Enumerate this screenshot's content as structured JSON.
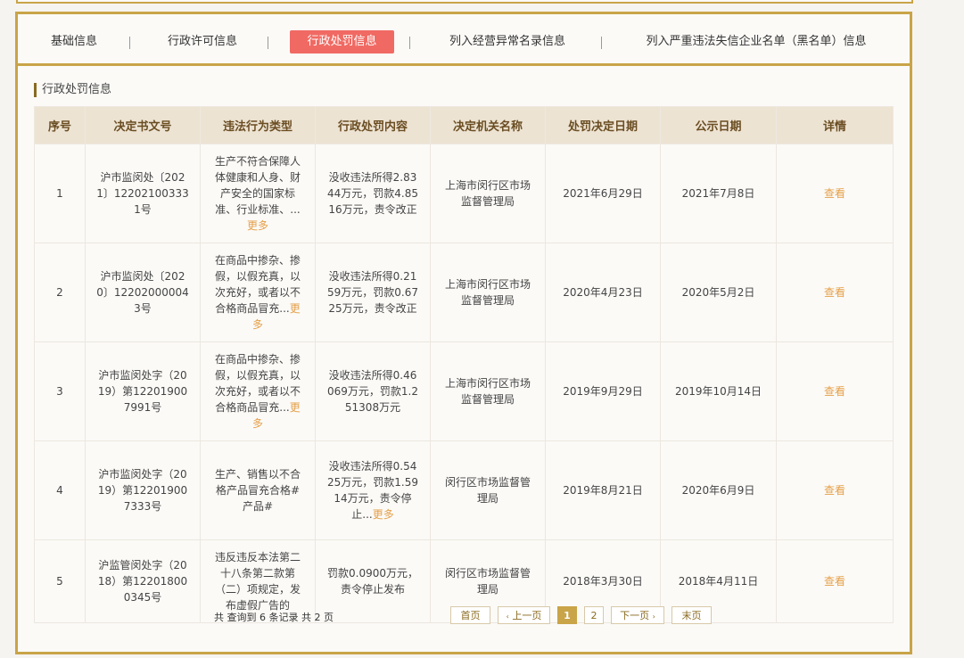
{
  "tabs": [
    {
      "label": "基础信息"
    },
    {
      "label": "行政许可信息"
    },
    {
      "label": "行政处罚信息",
      "active": true
    },
    {
      "label": "列入经营异常名录信息"
    },
    {
      "label": "列入严重违法失信企业名单（黑名单）信息"
    }
  ],
  "section_title": "行政处罚信息",
  "columns": [
    "序号",
    "决定书文号",
    "违法行为类型",
    "行政处罚内容",
    "决定机关名称",
    "处罚决定日期",
    "公示日期",
    "详情"
  ],
  "rows": [
    {
      "no": "1",
      "doc": "沪市监闵处〔2021〕122021003331号",
      "type": "生产不符合保障人体健康和人身、财产安全的国家标准、行业标准、...",
      "type_more": "更多",
      "content": "没收违法所得2.8344万元，罚款4.8516万元，责令改正",
      "content_more": "",
      "org": "上海市闵行区市场监督管理局",
      "date": "2021年6月29日",
      "pub": "2021年7月8日",
      "detail": "查看"
    },
    {
      "no": "2",
      "doc": "沪市监闵处〔2020〕122020000043号",
      "type": "在商品中掺杂、掺假，以假充真，以次充好，或者以不合格商品冒充...",
      "type_more": "更多",
      "content": "没收违法所得0.2159万元，罚款0.6725万元，责令改正",
      "content_more": "",
      "org": "上海市闵行区市场监督管理局",
      "date": "2020年4月23日",
      "pub": "2020年5月2日",
      "detail": "查看"
    },
    {
      "no": "3",
      "doc": "沪市监闵处字（2019）第122019007991号",
      "type": "在商品中掺杂、掺假，以假充真，以次充好，或者以不合格商品冒充...",
      "type_more": "更多",
      "content": "没收违法所得0.46069万元，罚款1.251308万元",
      "content_more": "",
      "org": "上海市闵行区市场监督管理局",
      "date": "2019年9月29日",
      "pub": "2019年10月14日",
      "detail": "查看"
    },
    {
      "no": "4",
      "doc": "沪市监闵处字（2019）第122019007333号",
      "type": "生产、销售以不合格产品冒充合格#产品#",
      "type_more": "",
      "content": "没收违法所得0.5425万元，罚款1.5914万元，责令停止...",
      "content_more": "更多",
      "org": "闵行区市场监督管理局",
      "date": "2019年8月21日",
      "pub": "2020年6月9日",
      "detail": "查看"
    },
    {
      "no": "5",
      "doc": "沪监管闵处字（2018）第122018000345号",
      "type": "违反违反本法第二十八条第二款第（二）项规定，发布虚假广告的",
      "type_more": "",
      "content": "罚款0.0900万元，责令停止发布",
      "content_more": "",
      "org": "闵行区市场监督管理局",
      "date": "2018年3月30日",
      "pub": "2018年4月11日",
      "detail": "查看"
    }
  ],
  "pager": {
    "info": "共 查询到 6 条记录 共 2 页",
    "first": "首页",
    "prev": "上一页",
    "pages": [
      "1",
      "2"
    ],
    "next": "下一页",
    "last": "末页",
    "prev_icon": "‹",
    "next_icon": "›"
  }
}
